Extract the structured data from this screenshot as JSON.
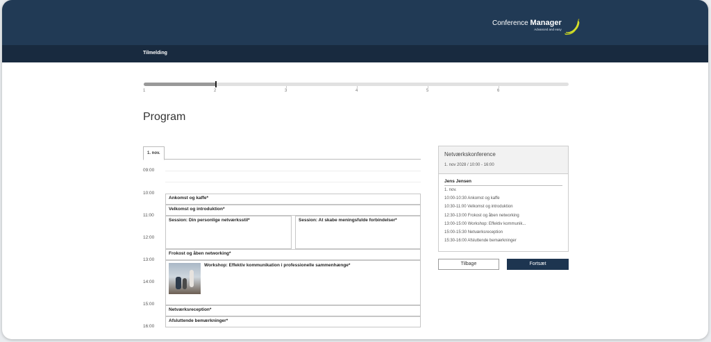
{
  "header": {
    "logo_prefix": "Conference",
    "logo_bold": "Manager",
    "logo_tagline": "Advanced and easy",
    "colors": {
      "header_bg": "#213a55",
      "nav_bg": "#182a3f",
      "logo_accent": "#d4df2a"
    }
  },
  "nav": {
    "item": "Tilmelding"
  },
  "progress": {
    "steps": [
      "1",
      "2",
      "3",
      "4",
      "5",
      "6"
    ],
    "current_step": 2
  },
  "page_title": "Program",
  "tabs": [
    {
      "label": "1. nov."
    }
  ],
  "schedule": {
    "hours": [
      "09:00",
      "10:00",
      "11:00",
      "12:00",
      "13:00",
      "14:00",
      "15:00",
      "16:00"
    ],
    "events": [
      {
        "title": "Ankomst og kaffe*"
      },
      {
        "title": "Velkomst og introduktion*"
      },
      {
        "title": "Session: Din personlige netværksstil*"
      },
      {
        "title": "Session: At skabe meningsfulde forbindelser*"
      },
      {
        "title": "Frokost og åben networking*"
      },
      {
        "title": "Workshop: Effektiv kommunikation i professionelle sammenhænge*"
      },
      {
        "title": "Netværksreception*"
      },
      {
        "title": "Afsluttende bemærkninger*"
      }
    ]
  },
  "summary": {
    "title": "Netværkskonference",
    "date": "1. nov 2028 / 10:00 - 16:00",
    "name": "Jens Jensen",
    "lines": [
      "1. nov.",
      "10:00-10:30 Ankomst og kaffe",
      "10:30-11:00 Velkomst og introduktion",
      "12:30-13:00 Frokost og åben networking",
      "13:00-15:00 Workshop: Effektiv kommunik...",
      "15:00-15:30 Netværksreception",
      "15:30-16:00 Afsluttende bemærkninger"
    ]
  },
  "buttons": {
    "back": "Tilbage",
    "next": "Fortsæt"
  }
}
